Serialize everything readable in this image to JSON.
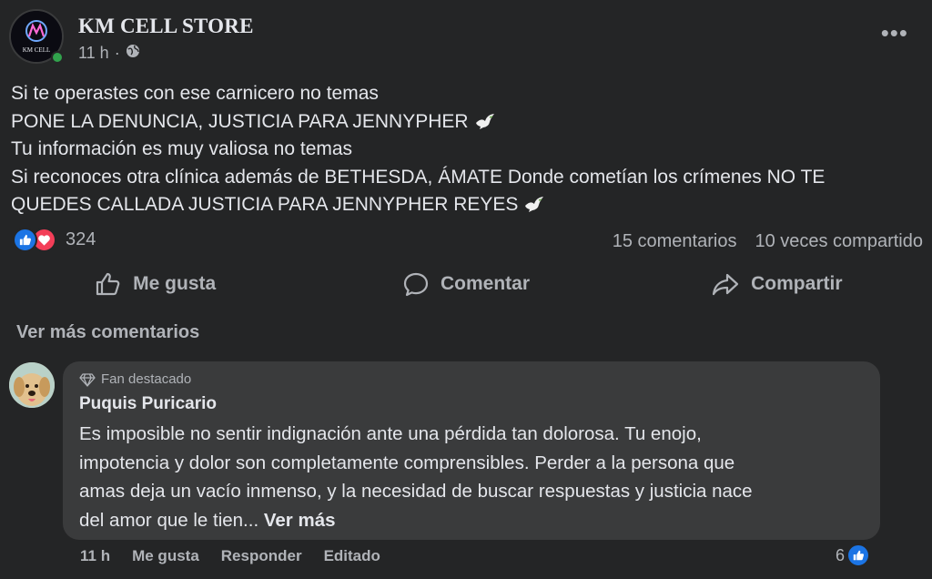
{
  "post": {
    "page_name": "KM CELL STORE",
    "avatar_text": "KM CELL",
    "time": "11 h",
    "privacy_icon": "globe-icon",
    "lines": [
      "Si te operastes con ese carnicero no temas",
      "PONE LA DENUNCIA, JUSTICIA PARA JENNYPHER",
      "Tu información es muy valiosa no temas",
      "Si reconoces otra clínica además de BETHESDA, ÁMATE  Donde cometían los crímenes NO TE",
      "QUEDES CALLADA JUSTICIA PARA JENNYPHER REYES"
    ],
    "emoji": "dove-icon"
  },
  "reactions": {
    "count": "324",
    "types": [
      "like-icon",
      "love-icon"
    ],
    "comments": "15 comentarios",
    "shares": "10 veces compartido"
  },
  "actions": {
    "like": "Me gusta",
    "comment": "Comentar",
    "share": "Compartir"
  },
  "comments": {
    "view_more": "Ver más comentarios",
    "items": [
      {
        "badge": "Fan destacado",
        "author": "Puquis Puricario",
        "lines": [
          "Es imposible no sentir indignación ante una pérdida tan dolorosa. Tu enojo,",
          "impotencia y dolor son completamente comprensibles. Perder a la persona que",
          "amas deja un vacío inmenso, y la necesidad de buscar respuestas y justicia nace",
          "del amor que le tien..."
        ],
        "see_more": "Ver más",
        "time": "11 h",
        "like": "Me gusta",
        "reply": "Responder",
        "edited": "Editado",
        "reaction_count": "6"
      }
    ]
  },
  "colors": {
    "background": "#242526",
    "bubble": "#3a3b3c",
    "text_primary": "#e4e6eb",
    "text_secondary": "#b0b3b8",
    "like_blue": "#1b74e4",
    "love_red": "#f33e58",
    "online_green": "#31a24c"
  }
}
